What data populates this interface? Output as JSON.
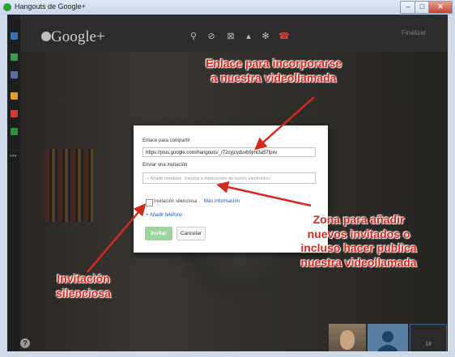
{
  "window": {
    "title": "Hangouts de Google+",
    "min_glyph": "–",
    "max_glyph": "□",
    "close_glyph": "✕"
  },
  "topbar": {
    "logo_text": "Google+",
    "finish_label": "Finalizar"
  },
  "icons": [
    "camera-icon",
    "mic-off-icon",
    "video-off-icon",
    "signal-icon",
    "settings-icon",
    "hangup-icon"
  ],
  "rail": {
    "dots": "•••"
  },
  "dialog": {
    "share_label": "Enlace para compartir",
    "share_link": "https://plus.google.com/hangouts/_/72cyjcvdsvb9jmi3a57lpxv",
    "invite_label": "Enviar una invitación",
    "invite_placeholder": "+ Añade nombres, círculos o direcciones de correo electrónico",
    "silent_label": "Invitación silenciosa",
    "more_info": "Más información",
    "add_phone": "+ Añadir teléfono",
    "invite_button": "Invitar",
    "cancel_button": "Cancelar"
  },
  "thumbnails": {
    "third_label": "18"
  },
  "help_glyph": "?",
  "annotations": {
    "top_line1": "Enlace para incorporarse",
    "top_line2": "a nuestra videollamada",
    "right_line1": "Zona para añadir",
    "right_line2": "nuevos invitados o",
    "right_line3": "incluso hacer publica",
    "right_line4": "nuestra videollamada",
    "left_line1": "Invitación",
    "left_line2": "silenciosa"
  },
  "colors": {
    "annotation": "#d6281d",
    "link": "#1155cc",
    "invite_button": "#9fd49f",
    "hangup": "#e0443b"
  }
}
